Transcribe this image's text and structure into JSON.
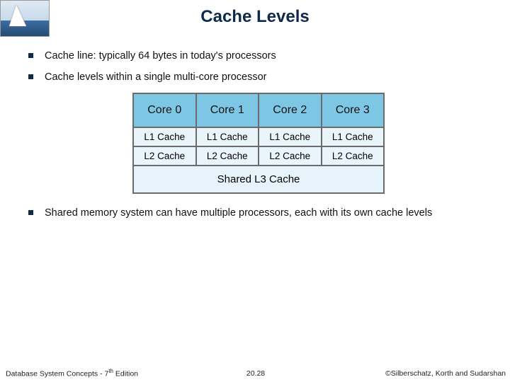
{
  "title": "Cache Levels",
  "bullets": {
    "b1": "Cache line: typically 64 bytes in today's processors",
    "b2": "Cache levels within a single multi-core processor",
    "b3": "Shared memory system can have multiple processors, each with its own cache levels"
  },
  "diagram": {
    "cores": [
      "Core 0",
      "Core 1",
      "Core 2",
      "Core 3"
    ],
    "l1": [
      "L1 Cache",
      "L1 Cache",
      "L1 Cache",
      "L1 Cache"
    ],
    "l2": [
      "L2 Cache",
      "L2 Cache",
      "L2 Cache",
      "L2 Cache"
    ],
    "l3": "Shared L3 Cache"
  },
  "footer": {
    "left_a": "Database System Concepts - 7",
    "left_b": " Edition",
    "center": "20.28",
    "right": "©Silberschatz, Korth and Sudarshan"
  }
}
